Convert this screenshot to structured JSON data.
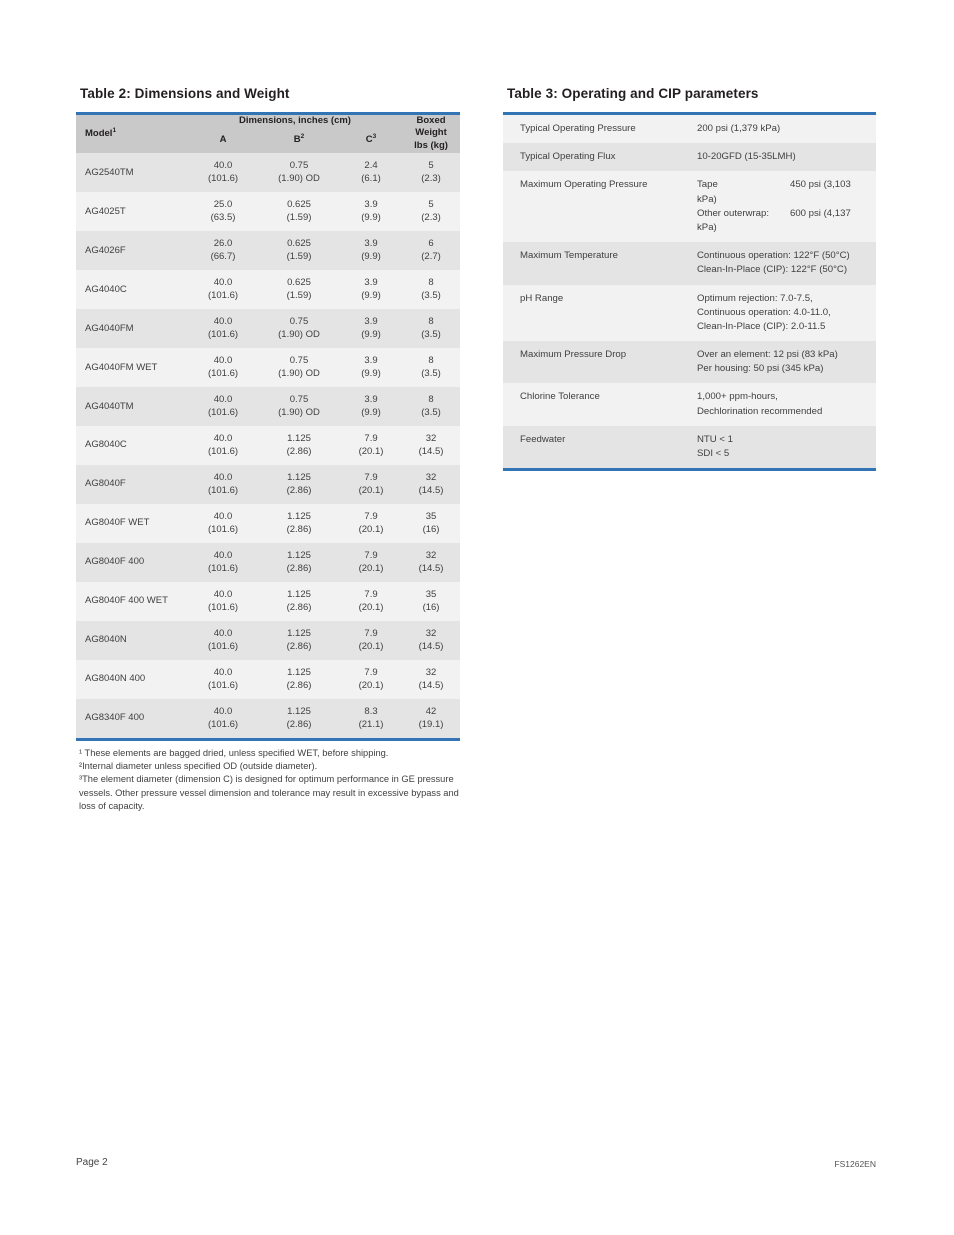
{
  "table2": {
    "title": "Table 2: Dimensions and Weight",
    "group_header": "Dimensions, inches (cm)",
    "boxed_header": "Boxed",
    "columns": {
      "model": "Model",
      "model_sup": "1",
      "a": "A",
      "b": "B",
      "b_sup": "2",
      "c": "C",
      "c_sup": "3",
      "weight_line1": "Weight",
      "weight_line2": "lbs (kg)"
    },
    "rows": [
      {
        "model": "AG2540TM",
        "a_in": "40.0",
        "a_cm": "(101.6)",
        "b_in": "0.75",
        "b_cm": "(1.90) OD",
        "c_in": "2.4",
        "c_cm": "(6.1)",
        "w_lb": "5",
        "w_kg": "(2.3)"
      },
      {
        "model": "AG4025T",
        "a_in": "25.0",
        "a_cm": "(63.5)",
        "b_in": "0.625",
        "b_cm": "(1.59)",
        "c_in": "3.9",
        "c_cm": "(9.9)",
        "w_lb": "5",
        "w_kg": "(2.3)"
      },
      {
        "model": "AG4026F",
        "a_in": "26.0",
        "a_cm": "(66.7)",
        "b_in": "0.625",
        "b_cm": "(1.59)",
        "c_in": "3.9",
        "c_cm": "(9.9)",
        "w_lb": "6",
        "w_kg": "(2.7)"
      },
      {
        "model": "AG4040C",
        "a_in": "40.0",
        "a_cm": "(101.6)",
        "b_in": "0.625",
        "b_cm": "(1.59)",
        "c_in": "3.9",
        "c_cm": "(9.9)",
        "w_lb": "8",
        "w_kg": "(3.5)"
      },
      {
        "model": "AG4040FM",
        "a_in": "40.0",
        "a_cm": "(101.6)",
        "b_in": "0.75",
        "b_cm": "(1.90) OD",
        "c_in": "3.9",
        "c_cm": "(9.9)",
        "w_lb": "8",
        "w_kg": "(3.5)"
      },
      {
        "model": "AG4040FM WET",
        "a_in": "40.0",
        "a_cm": "(101.6)",
        "b_in": "0.75",
        "b_cm": "(1.90) OD",
        "c_in": "3.9",
        "c_cm": "(9.9)",
        "w_lb": "8",
        "w_kg": "(3.5)"
      },
      {
        "model": "AG4040TM",
        "a_in": "40.0",
        "a_cm": "(101.6)",
        "b_in": "0.75",
        "b_cm": "(1.90) OD",
        "c_in": "3.9",
        "c_cm": "(9.9)",
        "w_lb": "8",
        "w_kg": "(3.5)"
      },
      {
        "model": "AG8040C",
        "a_in": "40.0",
        "a_cm": "(101.6)",
        "b_in": "1.125",
        "b_cm": "(2.86)",
        "c_in": "7.9",
        "c_cm": "(20.1)",
        "w_lb": "32",
        "w_kg": "(14.5)"
      },
      {
        "model": "AG8040F",
        "a_in": "40.0",
        "a_cm": "(101.6)",
        "b_in": "1.125",
        "b_cm": "(2.86)",
        "c_in": "7.9",
        "c_cm": "(20.1)",
        "w_lb": "32",
        "w_kg": "(14.5)"
      },
      {
        "model": "AG8040F WET",
        "a_in": "40.0",
        "a_cm": "(101.6)",
        "b_in": "1.125",
        "b_cm": "(2.86)",
        "c_in": "7.9",
        "c_cm": "(20.1)",
        "w_lb": "35",
        "w_kg": "(16)"
      },
      {
        "model": "AG8040F 400",
        "a_in": "40.0",
        "a_cm": "(101.6)",
        "b_in": "1.125",
        "b_cm": "(2.86)",
        "c_in": "7.9",
        "c_cm": "(20.1)",
        "w_lb": "32",
        "w_kg": "(14.5)"
      },
      {
        "model": "AG8040F 400 WET",
        "a_in": "40.0",
        "a_cm": "(101.6)",
        "b_in": "1.125",
        "b_cm": "(2.86)",
        "c_in": "7.9",
        "c_cm": "(20.1)",
        "w_lb": "35",
        "w_kg": "(16)"
      },
      {
        "model": "AG8040N",
        "a_in": "40.0",
        "a_cm": "(101.6)",
        "b_in": "1.125",
        "b_cm": "(2.86)",
        "c_in": "7.9",
        "c_cm": "(20.1)",
        "w_lb": "32",
        "w_kg": "(14.5)"
      },
      {
        "model": "AG8040N 400",
        "a_in": "40.0",
        "a_cm": "(101.6)",
        "b_in": "1.125",
        "b_cm": "(2.86)",
        "c_in": "7.9",
        "c_cm": "(20.1)",
        "w_lb": "32",
        "w_kg": "(14.5)"
      },
      {
        "model": "AG8340F 400",
        "a_in": "40.0",
        "a_cm": "(101.6)",
        "b_in": "1.125",
        "b_cm": "(2.86)",
        "c_in": "8.3",
        "c_cm": "(21.1)",
        "w_lb": "42",
        "w_kg": "(19.1)"
      }
    ],
    "footnotes": [
      "¹ These elements are bagged dried, unless specified WET, before shipping.",
      "²Internal diameter unless specified OD (outside diameter).",
      "³The element diameter (dimension C) is designed for optimum performance in GE pressure vessels. Other pressure vessel dimension and tolerance may result in excessive bypass and loss of capacity."
    ]
  },
  "table3": {
    "title": "Table 3: Operating and CIP parameters",
    "rows": [
      {
        "key": "Typical Operating Pressure",
        "lines": [
          "200 psi (1,379 kPa)"
        ]
      },
      {
        "key": "Typical Operating Flux",
        "lines": [
          "10-20GFD (15-35LMH)"
        ]
      },
      {
        "key": "Maximum Operating Pressure",
        "pairs": [
          {
            "label": "Tape",
            "value": "450 psi (3,103 kPa)"
          },
          {
            "label": "Other outerwrap:",
            "value": "600 psi (4,137 kPa)"
          }
        ]
      },
      {
        "key": "Maximum Temperature",
        "lines": [
          "Continuous operation: 122°F (50°C)",
          "Clean-In-Place (CIP): 122°F (50°C)"
        ]
      },
      {
        "key": "pH Range",
        "lines": [
          "Optimum rejection: 7.0-7.5,",
          "Continuous operation: 4.0-11.0,",
          "Clean-In-Place (CIP): 2.0-11.5"
        ]
      },
      {
        "key": "Maximum Pressure Drop",
        "lines": [
          "Over an element: 12 psi (83 kPa)",
          "Per housing: 50 psi (345 kPa)"
        ]
      },
      {
        "key": "Chlorine Tolerance",
        "lines": [
          "1,000+ ppm-hours,",
          "Dechlorination recommended"
        ]
      },
      {
        "key": "Feedwater",
        "lines": [
          "NTU < 1",
          "SDI < 5"
        ]
      }
    ]
  },
  "footer": {
    "page_label": "Page 2",
    "doc_id": "FS1262EN"
  },
  "colors": {
    "rule_blue": "#3374b4",
    "header_grey": "#c9c9c9",
    "row_dark": "#e4e4e4",
    "row_light": "#f2f2f2"
  }
}
